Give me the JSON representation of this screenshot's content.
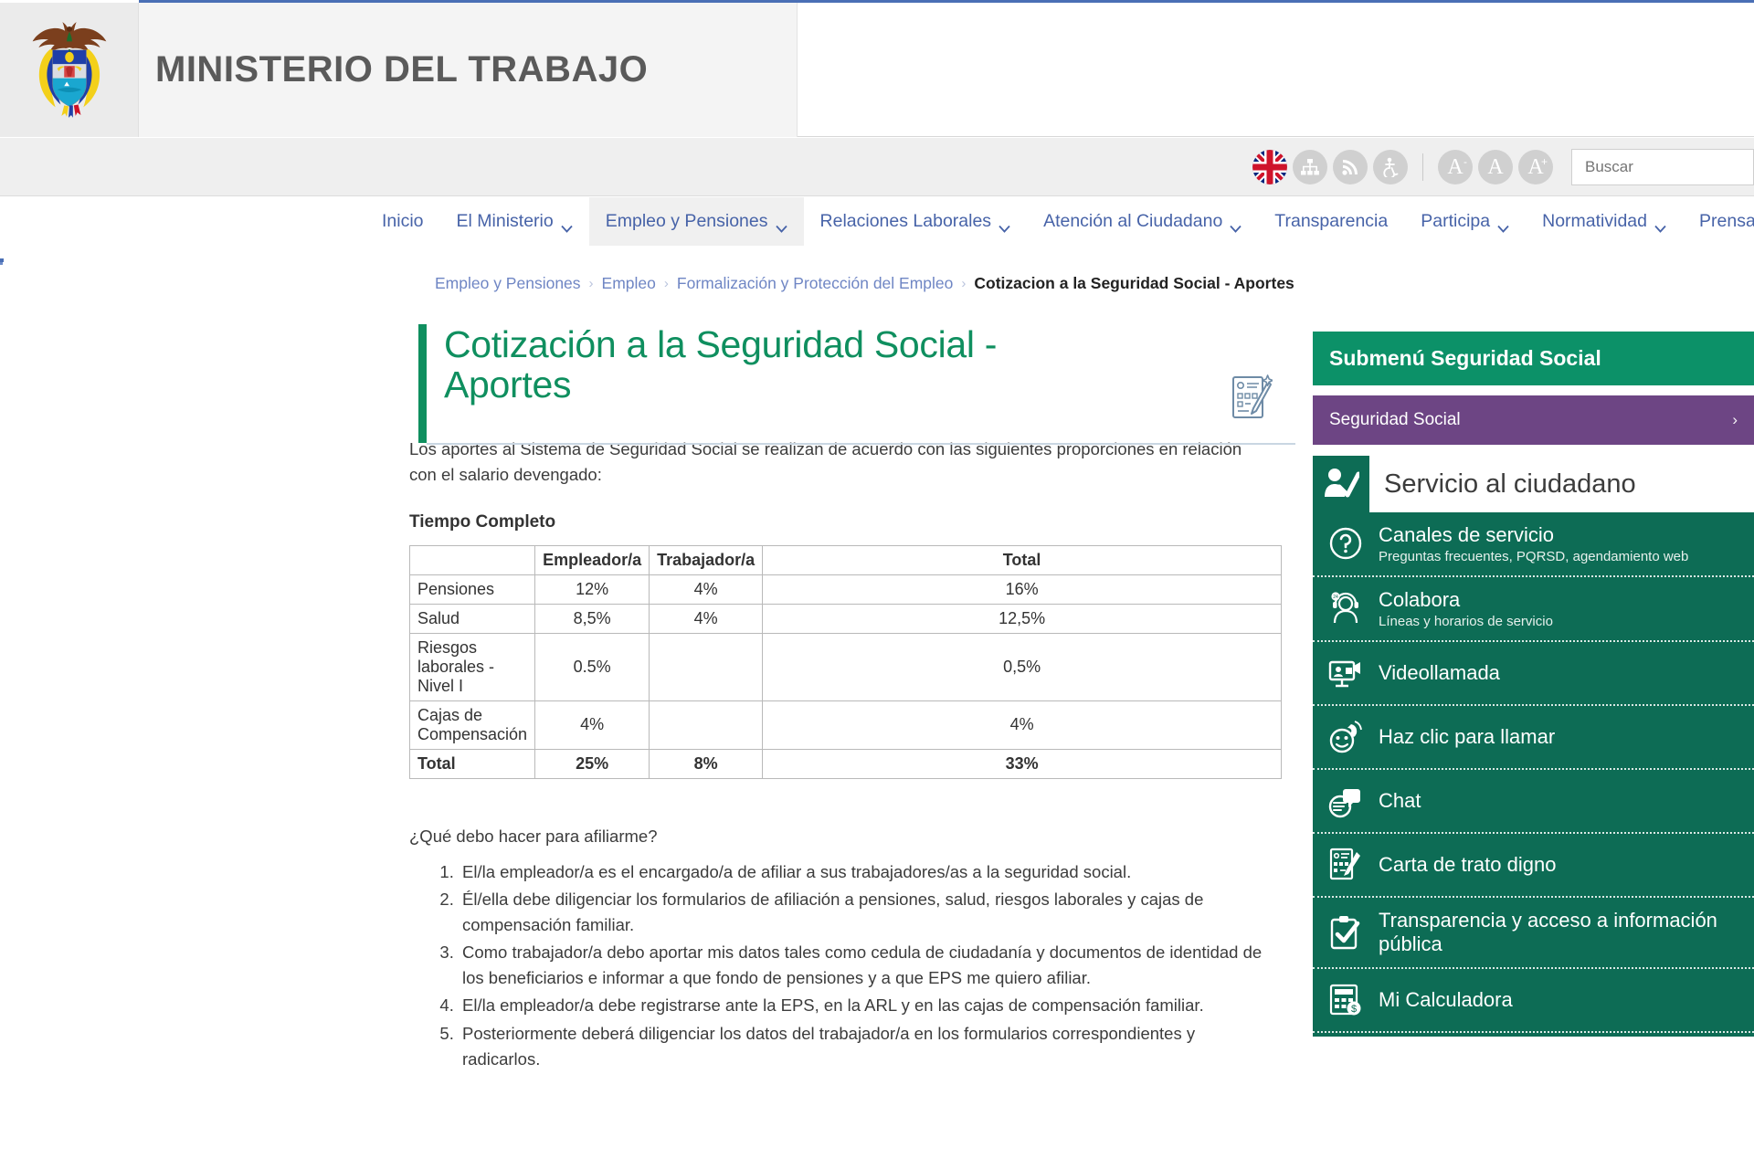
{
  "header": {
    "ministry_title": "MINISTERIO DEL TRABAJO",
    "logo_icon": "colombia-coat-of-arms"
  },
  "toolbar": {
    "icons": [
      {
        "name": "uk-flag-icon",
        "label": "English"
      },
      {
        "name": "sitemap-icon",
        "label": "Mapa del sitio"
      },
      {
        "name": "rss-icon",
        "label": "RSS"
      },
      {
        "name": "accessibility-icon",
        "label": "Accesibilidad"
      }
    ],
    "font_smaller": "A",
    "font_smaller_sup": "-",
    "font_normal": "A",
    "font_larger": "A",
    "font_larger_sup": "+",
    "search": {
      "placeholder": "Buscar",
      "value": ""
    }
  },
  "nav": {
    "items": [
      {
        "label": "Inicio",
        "has_dropdown": false,
        "active": false
      },
      {
        "label": "El Ministerio",
        "has_dropdown": true,
        "active": false
      },
      {
        "label": "Empleo y Pensiones",
        "has_dropdown": true,
        "active": true
      },
      {
        "label": "Relaciones Laborales",
        "has_dropdown": true,
        "active": false
      },
      {
        "label": "Atención al Ciudadano",
        "has_dropdown": true,
        "active": false
      },
      {
        "label": "Transparencia",
        "has_dropdown": false,
        "active": false
      },
      {
        "label": "Participa",
        "has_dropdown": true,
        "active": false
      },
      {
        "label": "Normatividad",
        "has_dropdown": true,
        "active": false
      },
      {
        "label": "Prensa",
        "has_dropdown": false,
        "active": false
      }
    ]
  },
  "breadcrumb": {
    "items": [
      "Empleo y Pensiones",
      "Empleo",
      "Formalización y Protección del Empleo"
    ],
    "current": "Cotizacion a la Seguridad Social - Aportes",
    "separator": "›"
  },
  "main": {
    "title": "Cotización a la Seguridad Social - Aportes",
    "title_icon": "form-document-pencil-icon",
    "lead": "Los aportes al Sistema de Seguridad Social se realizan de acuerdo con las siguientes proporciones en relación con el salario devengado:",
    "table_label": "Tiempo  Completo",
    "faq_question": "¿Qué debo hacer para afiliarme?",
    "faq_items": [
      "El/la empleador/a es el encargado/a de afiliar a sus trabajadores/as a la seguridad social.",
      "Él/ella debe diligenciar los formularios de afiliación a pensiones, salud, riesgos laborales y cajas de compensación familiar.",
      "Como trabajador/a debo aportar mis datos tales como cedula de ciudadanía  y documentos de identidad de los beneficiarios e informar a que fondo de pensiones y a que EPS me quiero afiliar.",
      "El/la empleador/a debe registrarse ante  la EPS, en la ARL y en las cajas de compensación familiar.",
      "Posteriormente deberá diligenciar los datos del trabajador/a en los formularios correspondientes y radicarlos."
    ]
  },
  "chart_data": {
    "type": "table",
    "title": "Tiempo  Completo",
    "columns": [
      "",
      "Empleador/a",
      "Trabajador/a",
      "Total"
    ],
    "rows": [
      {
        "concept": "Pensiones",
        "empleador": "12%",
        "trabajador": "4%",
        "total": "16%"
      },
      {
        "concept": "Salud",
        "empleador": "8,5%",
        "trabajador": "4%",
        "total": "12,5%"
      },
      {
        "concept": "Riesgos laborales - Nivel I",
        "empleador": "0.5%",
        "trabajador": "",
        "total": "0,5%"
      },
      {
        "concept": "Cajas de Compensación",
        "empleador": "4%",
        "trabajador": "",
        "total": "4%"
      },
      {
        "concept": "Total",
        "empleador": "25%",
        "trabajador": "8%",
        "total": "33%"
      }
    ]
  },
  "rail": {
    "submenu_title": "Submenú Seguridad Social",
    "submenu_item": {
      "label": "Seguridad Social",
      "arrow": "›"
    },
    "service_panel": {
      "heading": "Servicio al ciudadano",
      "heading_icon": "citizen-service-icon",
      "items": [
        {
          "icon": "question-circle-icon",
          "title": "Canales de servicio",
          "subtitle": "Preguntas frecuentes, PQRSD, agendamiento web"
        },
        {
          "icon": "headset-agent-icon",
          "title": "Colabora",
          "subtitle": "Líneas y horarios de servicio"
        },
        {
          "icon": "video-call-icon",
          "title": "Videollamada",
          "subtitle": ""
        },
        {
          "icon": "click-to-call-icon",
          "title": "Haz clic para llamar",
          "subtitle": ""
        },
        {
          "icon": "chat-bubble-icon",
          "title": "Chat",
          "subtitle": ""
        },
        {
          "icon": "document-pencil-icon",
          "title": "Carta de trato digno",
          "subtitle": ""
        },
        {
          "icon": "clipboard-check-icon",
          "title": "Transparencia y acceso a información pública",
          "subtitle": ""
        },
        {
          "icon": "calculator-icon",
          "title": "Mi Calculadora",
          "subtitle": ""
        }
      ]
    }
  },
  "colors": {
    "brand_green": "#0c9168",
    "rail_green": "#0d6c55",
    "title_green": "#0f8f5f",
    "purple": "#6d4584",
    "nav_blue": "#4763a8",
    "breadcrumb_blue": "#6f86c4"
  }
}
